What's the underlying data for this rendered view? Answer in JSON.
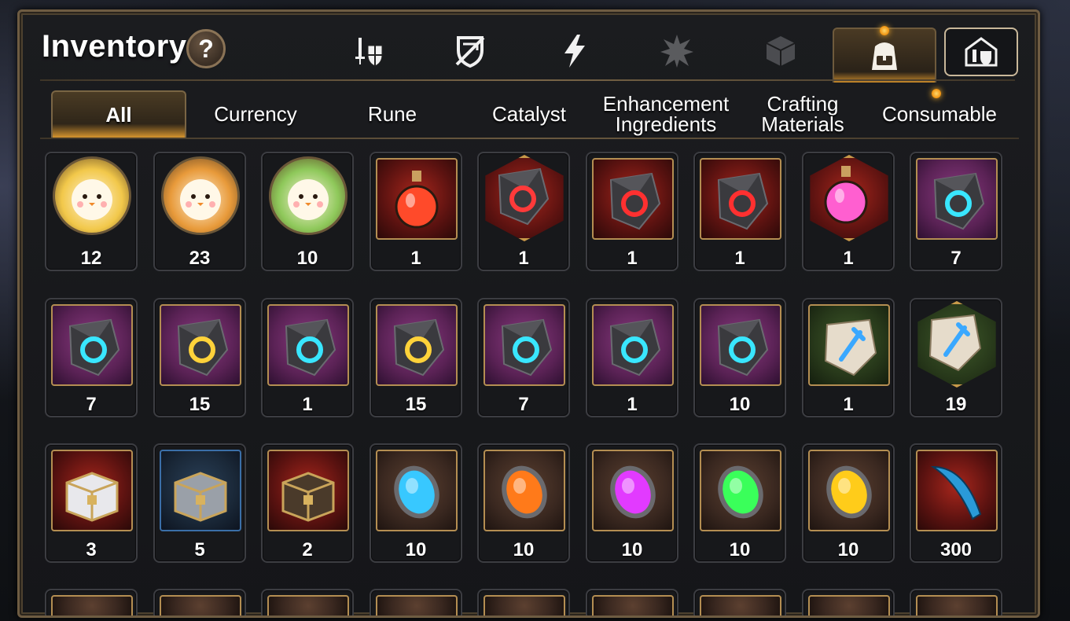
{
  "window": {
    "title": "Inventory",
    "help_label": "?"
  },
  "category_tabs": [
    {
      "icon": "sword-shield-icon",
      "active": false
    },
    {
      "icon": "broken-shield-icon",
      "active": false
    },
    {
      "icon": "lightning-icon",
      "active": false
    },
    {
      "icon": "artifact-burst-icon",
      "active": false
    },
    {
      "icon": "cube-icon",
      "active": false
    },
    {
      "icon": "backpack-icon",
      "active": true,
      "notify": true
    },
    {
      "icon": "house-gear-icon",
      "active": false
    }
  ],
  "sub_tabs": [
    {
      "label": "All",
      "active": true
    },
    {
      "label": "Currency",
      "active": false
    },
    {
      "label": "Rune",
      "active": false
    },
    {
      "label": "Catalyst",
      "active": false
    },
    {
      "label": "Enhancement\nIngredients",
      "active": false
    },
    {
      "label": "Crafting\nMaterials",
      "active": false
    },
    {
      "label": "Consumable",
      "active": false,
      "notify": true
    }
  ],
  "items": [
    {
      "name": "phantasma-gold-icon",
      "qty": "12"
    },
    {
      "name": "phantasma-orange-icon",
      "qty": "23"
    },
    {
      "name": "phantasma-green-icon",
      "qty": "10"
    },
    {
      "name": "red-potion-icon",
      "qty": "1"
    },
    {
      "name": "red-star-gem-icon",
      "qty": "1"
    },
    {
      "name": "red-ring-gem-icon",
      "qty": "1"
    },
    {
      "name": "red-necklace-gem-icon",
      "qty": "1"
    },
    {
      "name": "pink-potion-icon",
      "qty": "1"
    },
    {
      "name": "rune-armor-icon",
      "qty": "7"
    },
    {
      "name": "rune-helm-icon",
      "qty": "7"
    },
    {
      "name": "rune-hammer-icon",
      "qty": "15"
    },
    {
      "name": "rune-necklace-icon",
      "qty": "1"
    },
    {
      "name": "rune-blade-icon",
      "qty": "15"
    },
    {
      "name": "rune-boot-icon",
      "qty": "7"
    },
    {
      "name": "rune-ring-icon",
      "qty": "1"
    },
    {
      "name": "rune-sword-icon",
      "qty": "10"
    },
    {
      "name": "stone-sword-rune-icon",
      "qty": "1"
    },
    {
      "name": "stone-star-rune-icon",
      "qty": "19"
    },
    {
      "name": "white-chest-icon",
      "qty": "3"
    },
    {
      "name": "silver-chest-icon",
      "qty": "5"
    },
    {
      "name": "gold-chest-icon",
      "qty": "2"
    },
    {
      "name": "blue-catalyst-icon",
      "qty": "10"
    },
    {
      "name": "orange-catalyst-icon",
      "qty": "10"
    },
    {
      "name": "purple-catalyst-icon",
      "qty": "10"
    },
    {
      "name": "green-catalyst-icon",
      "qty": "10"
    },
    {
      "name": "yellow-catalyst-icon",
      "qty": "10"
    },
    {
      "name": "blue-feather-icon",
      "qty": "300"
    }
  ],
  "colors": {
    "accent_gold": "#d6952e",
    "frame": "#6e5c42",
    "notify": "#f0900c"
  }
}
